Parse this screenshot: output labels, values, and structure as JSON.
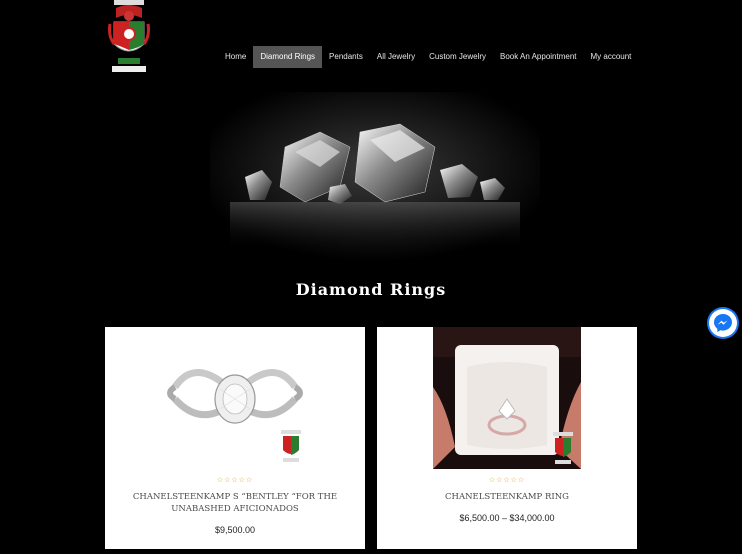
{
  "nav": {
    "items": [
      {
        "label": "Home"
      },
      {
        "label": "Diamond Rings"
      },
      {
        "label": "Pendants"
      },
      {
        "label": "All Jewelry"
      },
      {
        "label": "Custom Jewelry"
      },
      {
        "label": "Book An Appointment"
      },
      {
        "label": "My account"
      }
    ],
    "active_index": 1
  },
  "page": {
    "title": "Diamond Rings"
  },
  "products": [
    {
      "name": "CHANELSTEENKAMP S “BENTLEY “FOR THE UNABASHED AFICIONADOS",
      "price": "$9,500.00",
      "rating_stars": "☆☆☆☆☆"
    },
    {
      "name": "CHANELSTEENKAMP RING",
      "price": "$6,500.00 – $34,000.00",
      "rating_stars": "☆☆☆☆☆"
    }
  ],
  "icons": {
    "logo": "family-crest-logo",
    "messenger": "messenger-icon"
  },
  "colors": {
    "background": "#000000",
    "active_nav": "#555555",
    "star": "#d9a13a",
    "messenger": "#1877f2"
  }
}
